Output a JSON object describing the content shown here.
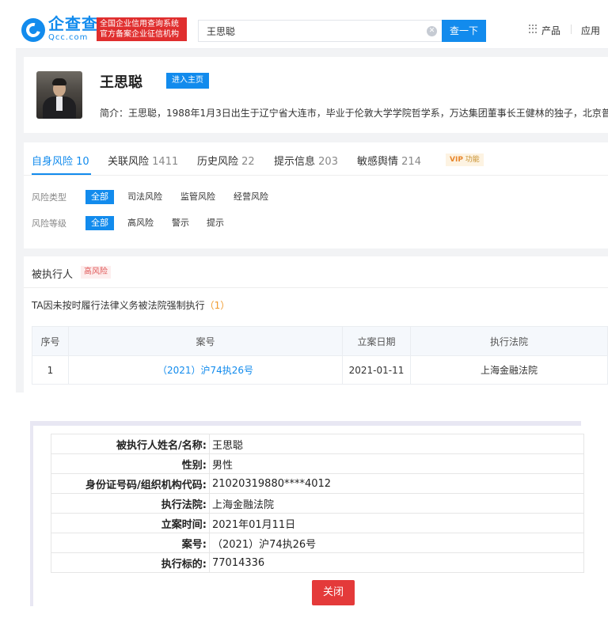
{
  "header": {
    "brand_cn": "企查查",
    "brand_en": "Qcc.com",
    "slogan_line1": "全国企业信用查询系统",
    "slogan_line2": "官方备案企业征信机构",
    "search_value": "王思聪",
    "search_button": "查一下",
    "nav_products": "产品",
    "nav_apps": "应用"
  },
  "profile": {
    "name": "王思聪",
    "home_button": "进入主页",
    "intro": "简介：王思聪，1988年1月3日出生于辽宁省大连市，毕业于伦敦大学学院哲学系，万达集团董事长王健林的独子，北京普思"
  },
  "tabs": [
    {
      "label": "自身风险",
      "count": "10"
    },
    {
      "label": "关联风险",
      "count": "1411"
    },
    {
      "label": "历史风险",
      "count": "22"
    },
    {
      "label": "提示信息",
      "count": "203"
    },
    {
      "label": "敏感舆情",
      "count": "214"
    }
  ],
  "vip": {
    "badge": "VIP",
    "label": "功能"
  },
  "filters": {
    "type_label": "风险类型",
    "type_options": [
      "全部",
      "司法风险",
      "监管风险",
      "经营风险"
    ],
    "level_label": "风险等级",
    "level_options": [
      "全部",
      "高风险",
      "警示",
      "提示"
    ]
  },
  "record": {
    "title": "被执行人",
    "risk_tag": "高风险",
    "desc": "TA因未按时履行法律义务被法院强制执行",
    "desc_count": "（1）",
    "columns": [
      "序号",
      "案号",
      "立案日期",
      "执行法院"
    ],
    "rows": [
      {
        "index": "1",
        "case_no": "（2021）沪74执26号",
        "date": "2021-01-11",
        "court": "上海金融法院"
      }
    ]
  },
  "detail": {
    "rows": [
      {
        "key": "被执行人姓名/名称:",
        "value": "王思聪"
      },
      {
        "key": "性别:",
        "value": "男性"
      },
      {
        "key": "身份证号码/组织机构代码:",
        "value": "21020319880****4012"
      },
      {
        "key": "执行法院:",
        "value": "上海金融法院"
      },
      {
        "key": "立案时间:",
        "value": "2021年01月11日"
      },
      {
        "key": "案号:",
        "value": "（2021）沪74执26号"
      },
      {
        "key": "执行标的:",
        "value": "77014336"
      }
    ],
    "close_button": "关闭"
  },
  "colors": {
    "brand_blue": "#128bed",
    "slogan_red": "#e02e2e",
    "close_red": "#e43a3a",
    "risk_red": "#e05656"
  }
}
